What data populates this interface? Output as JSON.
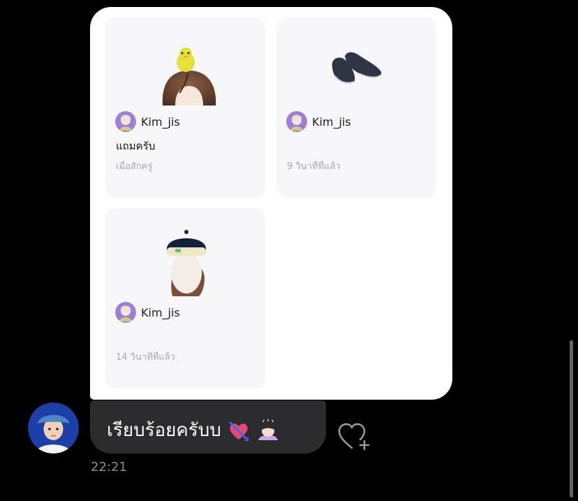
{
  "items": [
    {
      "author": "Kim_jis",
      "caption": "แถมครับ",
      "time": "เมื่อสักครู่",
      "image_icon": "hair-with-chick-icon"
    },
    {
      "author": "Kim_jis",
      "caption": "",
      "time": "9 วินาทีที่แล้ว",
      "image_icon": "shoes-icon"
    },
    {
      "author": "Kim_jis",
      "caption": "",
      "time": "14 วินาทีที่แล้ว",
      "image_icon": "cap-headband-icon"
    }
  ],
  "message": {
    "text": "เรียบร้อยครับบ",
    "emojis": [
      "heart-arrow-icon",
      "bowing-person-icon"
    ],
    "time": "22:21"
  },
  "actions": {
    "like_icon": "heart-plus-icon"
  },
  "colors": {
    "background": "#000000",
    "panel": "#ffffff",
    "card": "#f7f7f9",
    "bubble": "#2c2c2e",
    "muted_text": "#a8a8ae"
  }
}
